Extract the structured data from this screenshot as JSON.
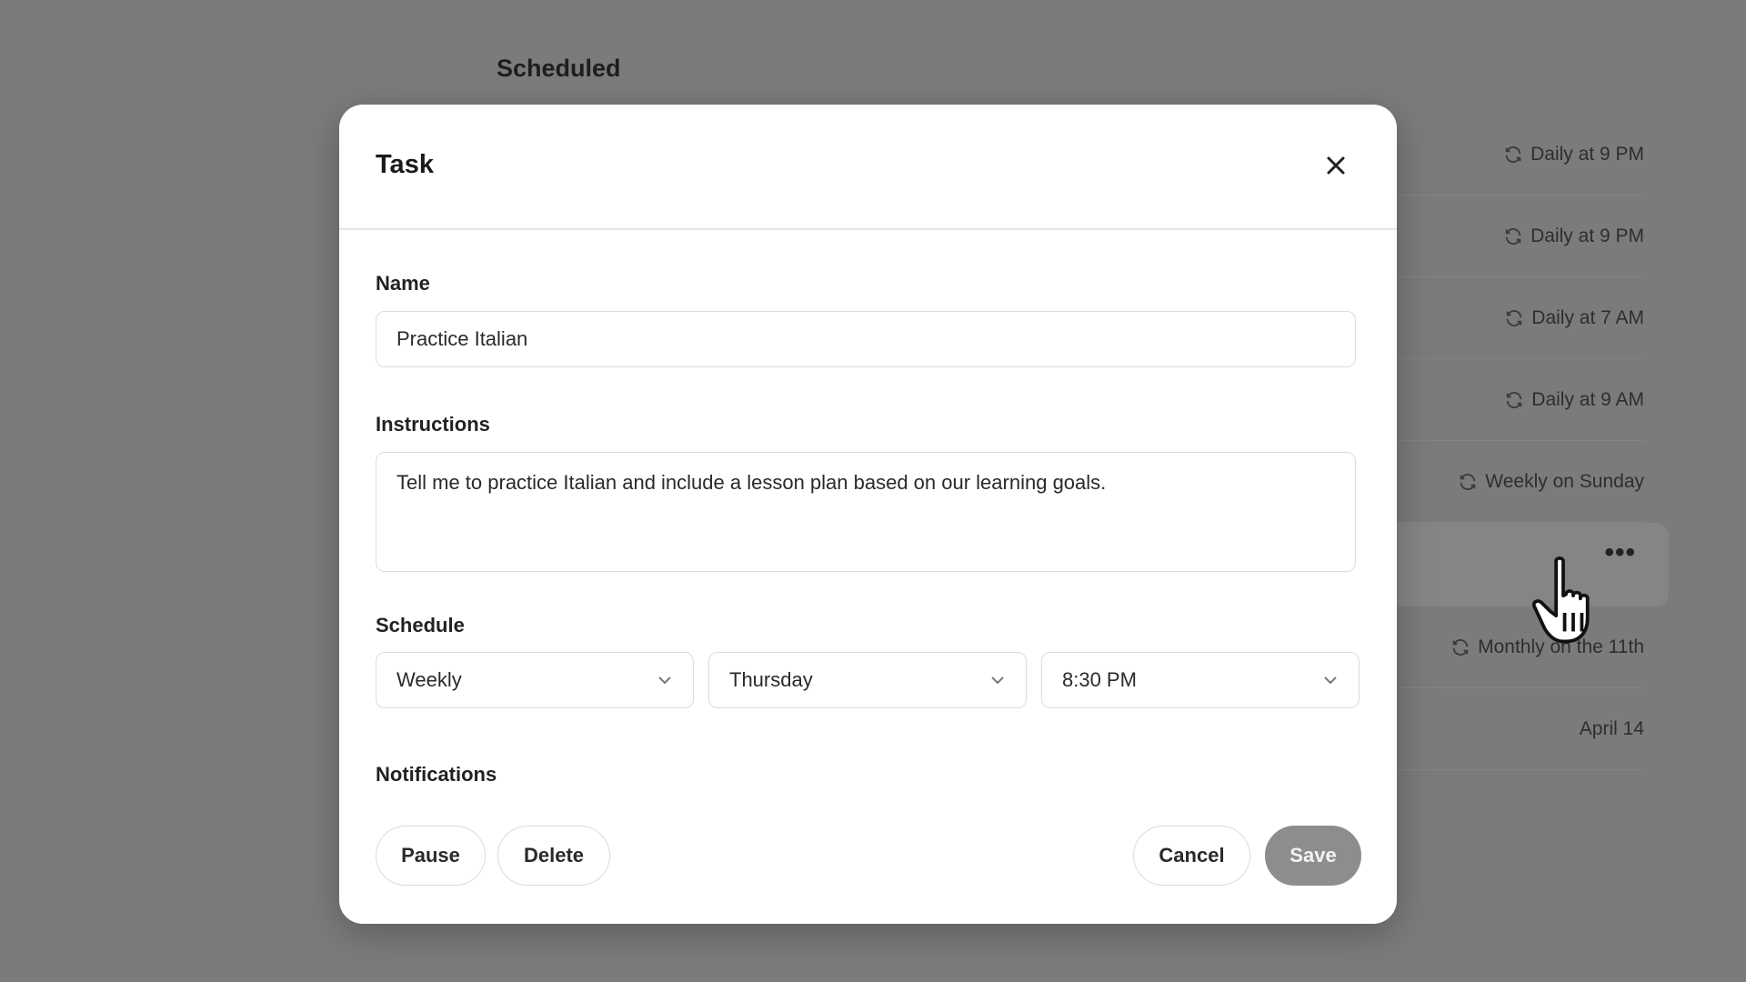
{
  "background": {
    "section_title": "Scheduled",
    "rows": [
      {
        "schedule": "Daily at 9 PM",
        "icon": "cycle-icon"
      },
      {
        "schedule": "Daily at 9 PM",
        "icon": "cycle-icon"
      },
      {
        "schedule": "Daily at 7 AM",
        "icon": "cycle-icon"
      },
      {
        "schedule": "Daily at 9 AM",
        "icon": "cycle-icon"
      },
      {
        "schedule": "Weekly on Sunday",
        "icon": "cycle-icon"
      },
      {
        "schedule": "",
        "icon": "more-icon",
        "more": "•••"
      },
      {
        "schedule": "Monthly on the 11th",
        "icon": "cycle-icon"
      },
      {
        "schedule": "April 14",
        "icon": ""
      }
    ]
  },
  "dialog": {
    "title": "Task",
    "close_icon": "close-icon",
    "name": {
      "label": "Name",
      "value": "Practice Italian"
    },
    "instructions": {
      "label": "Instructions",
      "value": "Tell me to practice Italian and include a lesson plan based on our learning goals."
    },
    "schedule": {
      "label": "Schedule",
      "frequency": "Weekly",
      "day": "Thursday",
      "time": "8:30 PM"
    },
    "notifications": {
      "label": "Notifications"
    },
    "buttons": {
      "pause": "Pause",
      "delete": "Delete",
      "cancel": "Cancel",
      "save": "Save"
    }
  },
  "colors": {
    "overlay": "#7b7b7b",
    "dialog_bg": "#ffffff",
    "save_button": "#8d8d8d"
  }
}
